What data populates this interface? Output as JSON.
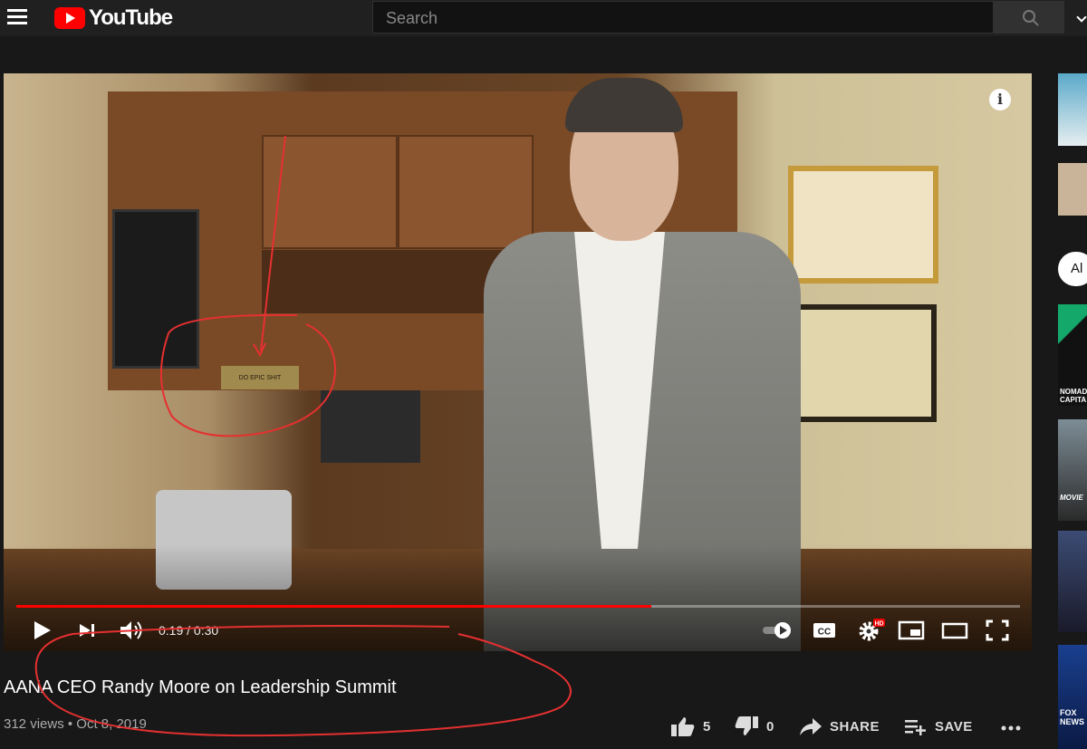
{
  "header": {
    "logo_text": "YouTube",
    "search_placeholder": "Search"
  },
  "player": {
    "plaque_text": "DO EPIC SHIT",
    "progress": 0.633,
    "time": "0:19 / 0:30",
    "hd_badge": "HD",
    "cc_label": "CC"
  },
  "video": {
    "title": "AANA CEO Randy Moore on Leadership Summit",
    "meta": "312 views • Oct 8, 2019",
    "likes": "5",
    "dislikes": "0",
    "share_label": "SHARE",
    "save_label": "SAVE"
  },
  "sidebar": {
    "chip_label": "Al",
    "thumb_texts": [
      "NOMAD CAPITA",
      "MOVIE",
      "FOX NEWS"
    ]
  },
  "colors": {
    "brand_red": "#ff0000",
    "annotation_red": "#e53030"
  }
}
